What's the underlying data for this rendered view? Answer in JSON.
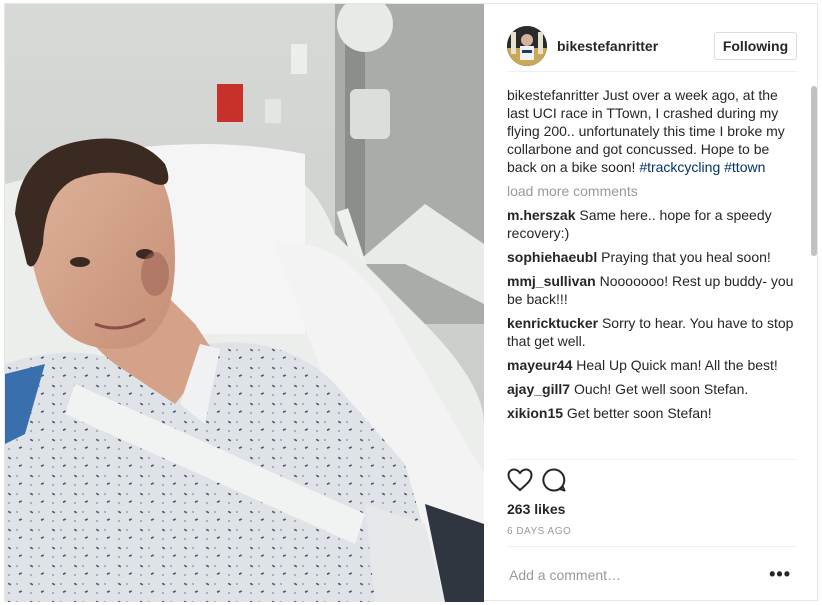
{
  "post": {
    "author": "bikestefanritter",
    "follow_label": "Following",
    "caption": {
      "username": "bikestefanritter",
      "text": "Just over a week ago, at the last UCI race in TTown, I crashed during my flying 200.. unfortunately this time I broke my collarbone and got concussed. Hope to be back on a bike soon!",
      "tags": [
        "#trackcycling",
        "#ttown"
      ]
    },
    "load_more_label": "load more comments",
    "comments": [
      {
        "username": "m.herszak",
        "text": "Same here.. hope for a speedy recovery:)"
      },
      {
        "username": "sophiehaeubl",
        "text": "Praying that you heal soon!"
      },
      {
        "username": "mmj_sullivan",
        "text": "Nooooooo! Rest up buddy- you be back!!!"
      },
      {
        "username": "kenricktucker",
        "text": "Sorry to hear. You have to stop that get well."
      },
      {
        "username": "mayeur44",
        "text": "Heal Up Quick man! All the best!"
      },
      {
        "username": "ajay_gill7",
        "text": "Ouch! Get well soon Stefan."
      },
      {
        "username": "xikion15",
        "text": "Get better soon Stefan!"
      }
    ],
    "likes": "263 likes",
    "time_ago": "6 DAYS AGO",
    "comment_placeholder": "Add a comment…",
    "more_label": "•••"
  },
  "icons": {
    "like": "heart-icon",
    "comment": "speech-bubble-icon",
    "more": "ellipsis-icon"
  },
  "colors": {
    "hashtag": "#003569",
    "muted": "#999999",
    "text": "#262626",
    "border": "#efefef"
  }
}
